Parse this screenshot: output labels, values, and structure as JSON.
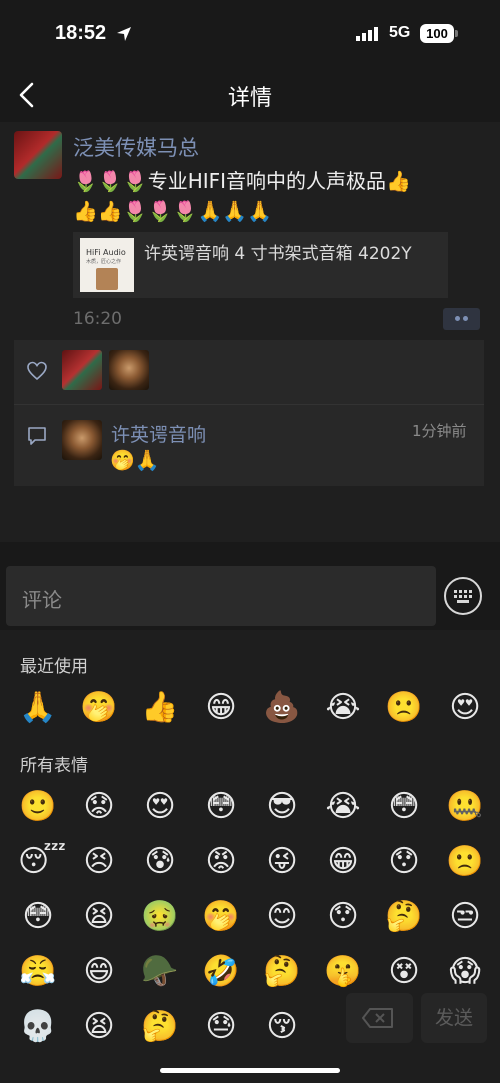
{
  "status": {
    "time": "18:52",
    "network": "5G",
    "battery": "100"
  },
  "nav": {
    "title": "详情"
  },
  "post": {
    "author": "泛美传媒马总",
    "line1": "🌷🌷🌷专业HIFI音响中的人声极品👍",
    "line2": "👍👍🌷🌷🌷🙏🙏🙏",
    "link": {
      "thumb_label": "HiFi Audio",
      "thumb_sub": "木质，匠心之作",
      "title": "许英谔音响 4 寸书架式音箱 4202Y"
    },
    "time": "16:20"
  },
  "comment": {
    "author": "许英谔音响",
    "time": "1分钟前",
    "text": "🤭🙏"
  },
  "input": {
    "placeholder": "评论"
  },
  "emoji_panel": {
    "recent_label": "最近使用",
    "all_label": "所有表情",
    "recent": [
      "🙏",
      "🤭",
      "👍",
      "😁",
      "💩",
      "😭",
      "🙁",
      "😍"
    ],
    "all": [
      "🙂",
      "😟",
      "😍",
      "😳",
      "😎",
      "😭",
      "😳",
      "🤐",
      "😴",
      "😣",
      "😰",
      "😡",
      "😜",
      "😁",
      "😯",
      "🙁",
      "😳",
      "😫",
      "🤢",
      "🤭",
      "😊",
      "😯",
      "🤔",
      "😒",
      "😤",
      "😄",
      "🪖",
      "🤣",
      "🤔",
      "🤫",
      "😵",
      "😱",
      "💀",
      "😫",
      "🤔",
      "😓",
      "😚"
    ],
    "send_label": "发送"
  }
}
